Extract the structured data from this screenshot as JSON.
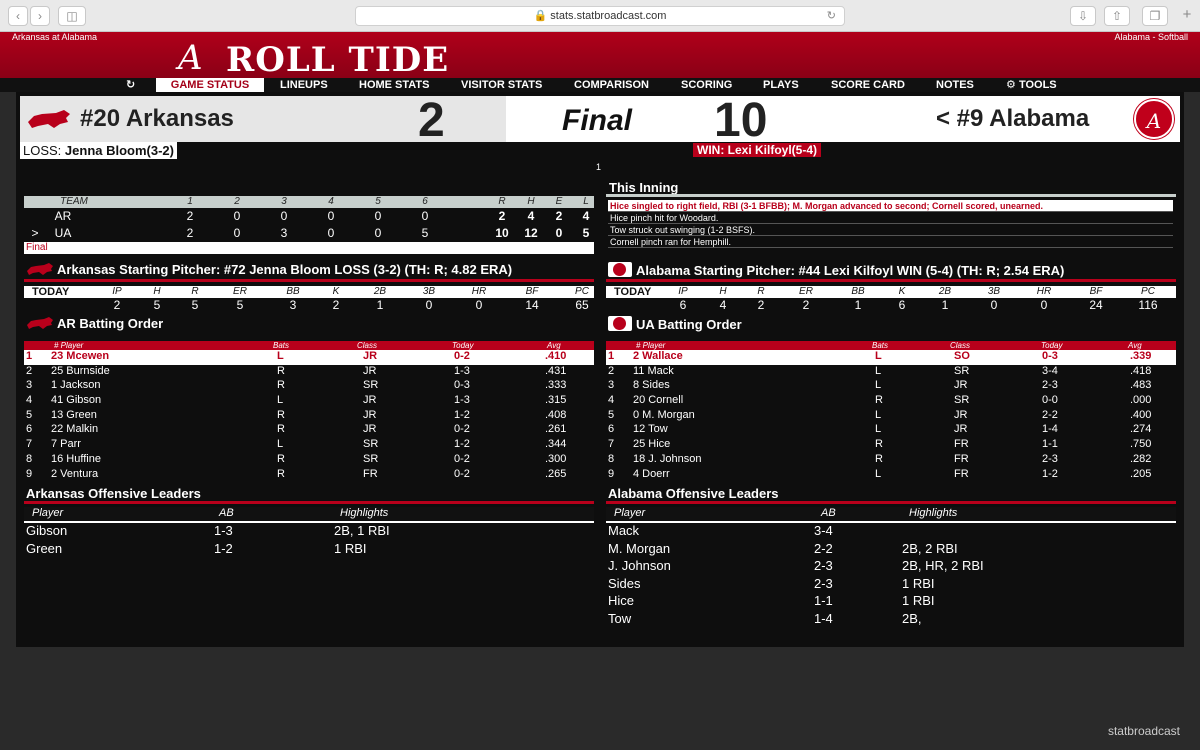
{
  "browser": {
    "url": "stats.statbroadcast.com"
  },
  "banner": {
    "left_text": "Arkansas at Alabama",
    "right_text": "Alabama - Softball",
    "logo_letter": "A",
    "logo_text": "ROLL TIDE"
  },
  "nav": [
    "GAME STATUS",
    "LINEUPS",
    "HOME STATS",
    "VISITOR STATS",
    "COMPARISON",
    "SCORING",
    "PLAYS",
    "SCORE CARD",
    "NOTES",
    "TOOLS"
  ],
  "score": {
    "away_team": "#20 Arkansas",
    "away_score": "2",
    "status": "Final",
    "home_score": "10",
    "home_team": "< #9 Alabama",
    "loss_label": "LOSS:",
    "loss_pitcher": "Jenna Bloom(3-2)",
    "win_text": "WIN: Lexi Kilfoyl(5-4)",
    "marker": "1"
  },
  "linescore": {
    "headers": [
      "TEAM",
      "1",
      "2",
      "3",
      "4",
      "5",
      "6",
      "R",
      "H",
      "E",
      "L"
    ],
    "rows": [
      {
        "ind": "",
        "team": "AR",
        "innings": [
          "2",
          "0",
          "0",
          "0",
          "0",
          "0"
        ],
        "r": "2",
        "h": "4",
        "e": "2",
        "l": "4"
      },
      {
        "ind": ">",
        "team": "UA",
        "innings": [
          "2",
          "0",
          "3",
          "0",
          "0",
          "5"
        ],
        "r": "10",
        "h": "12",
        "e": "0",
        "l": "5"
      }
    ],
    "final": "Final"
  },
  "this_inning": {
    "title": "This Inning",
    "plays": [
      "Hice singled to right field, RBI (3-1 BFBB); M. Morgan advanced to second; Cornell scored, unearned.",
      "Hice pinch hit for Woodard.",
      "Tow struck out swinging (1-2 BSFS).",
      "Cornell pinch ran for Hemphill."
    ]
  },
  "pitch_headers": [
    "IP",
    "H",
    "R",
    "ER",
    "BB",
    "K",
    "2B",
    "3B",
    "HR",
    "BF",
    "PC"
  ],
  "ar_pitcher": {
    "title": "Arkansas Starting Pitcher: #72 Jenna Bloom LOSS (3-2) (TH: R; 4.82 ERA)",
    "today": "TODAY",
    "values": [
      "2",
      "5",
      "5",
      "5",
      "3",
      "2",
      "1",
      "0",
      "0",
      "14",
      "65"
    ]
  },
  "ua_pitcher": {
    "title": "Alabama Starting Pitcher: #44 Lexi Kilfoyl WIN (5-4) (TH: R; 2.54 ERA)",
    "today": "TODAY",
    "values": [
      "6",
      "4",
      "2",
      "2",
      "1",
      "6",
      "1",
      "0",
      "0",
      "24",
      "116"
    ]
  },
  "bo_headers": [
    "# Player",
    "Bats",
    "Class",
    "Today",
    "Avg"
  ],
  "ar_batting": {
    "title": "AR Batting Order",
    "rows": [
      [
        "1",
        "23 Mcewen",
        "L",
        "JR",
        "0-2",
        ".410"
      ],
      [
        "2",
        "25 Burnside",
        "R",
        "JR",
        "1-3",
        ".431"
      ],
      [
        "3",
        "1 Jackson",
        "R",
        "SR",
        "0-3",
        ".333"
      ],
      [
        "4",
        "41 Gibson",
        "L",
        "JR",
        "1-3",
        ".315"
      ],
      [
        "5",
        "13 Green",
        "R",
        "JR",
        "1-2",
        ".408"
      ],
      [
        "6",
        "22 Malkin",
        "R",
        "JR",
        "0-2",
        ".261"
      ],
      [
        "7",
        "7 Parr",
        "L",
        "SR",
        "1-2",
        ".344"
      ],
      [
        "8",
        "16 Huffine",
        "R",
        "SR",
        "0-2",
        ".300"
      ],
      [
        "9",
        "2 Ventura",
        "R",
        "FR",
        "0-2",
        ".265"
      ]
    ]
  },
  "ua_batting": {
    "title": "UA Batting Order",
    "rows": [
      [
        "1",
        "2 Wallace",
        "L",
        "SO",
        "0-3",
        ".339"
      ],
      [
        "2",
        "11 Mack",
        "L",
        "SR",
        "3-4",
        ".418"
      ],
      [
        "3",
        "8 Sides",
        "L",
        "JR",
        "2-3",
        ".483"
      ],
      [
        "4",
        "20 Cornell",
        "R",
        "SR",
        "0-0",
        ".000"
      ],
      [
        "5",
        "0 M. Morgan",
        "L",
        "JR",
        "2-2",
        ".400"
      ],
      [
        "6",
        "12 Tow",
        "L",
        "JR",
        "1-4",
        ".274"
      ],
      [
        "7",
        "25 Hice",
        "R",
        "FR",
        "1-1",
        ".750"
      ],
      [
        "8",
        "18 J. Johnson",
        "R",
        "FR",
        "2-3",
        ".282"
      ],
      [
        "9",
        "4 Doerr",
        "L",
        "FR",
        "1-2",
        ".205"
      ]
    ]
  },
  "lead_headers": [
    "Player",
    "AB",
    "Highlights"
  ],
  "ar_leaders": {
    "title": "Arkansas Offensive Leaders",
    "rows": [
      [
        "Gibson",
        "1-3",
        "2B, 1 RBI"
      ],
      [
        "Green",
        "1-2",
        "1 RBI"
      ]
    ]
  },
  "ua_leaders": {
    "title": "Alabama Offensive Leaders",
    "rows": [
      [
        "Mack",
        "3-4",
        ""
      ],
      [
        "M. Morgan",
        "2-2",
        "2B, 2 RBI"
      ],
      [
        "J. Johnson",
        "2-3",
        "2B, HR, 2 RBI"
      ],
      [
        "Sides",
        "2-3",
        "1 RBI"
      ],
      [
        "Hice",
        "1-1",
        "1 RBI"
      ],
      [
        "Tow",
        "1-4",
        "2B,"
      ]
    ]
  },
  "brand": "statbroadcast",
  "colors": {
    "crimson": "#b8001b",
    "panel": "#0e0e0e",
    "divider_gray": "#c7cfcc"
  }
}
